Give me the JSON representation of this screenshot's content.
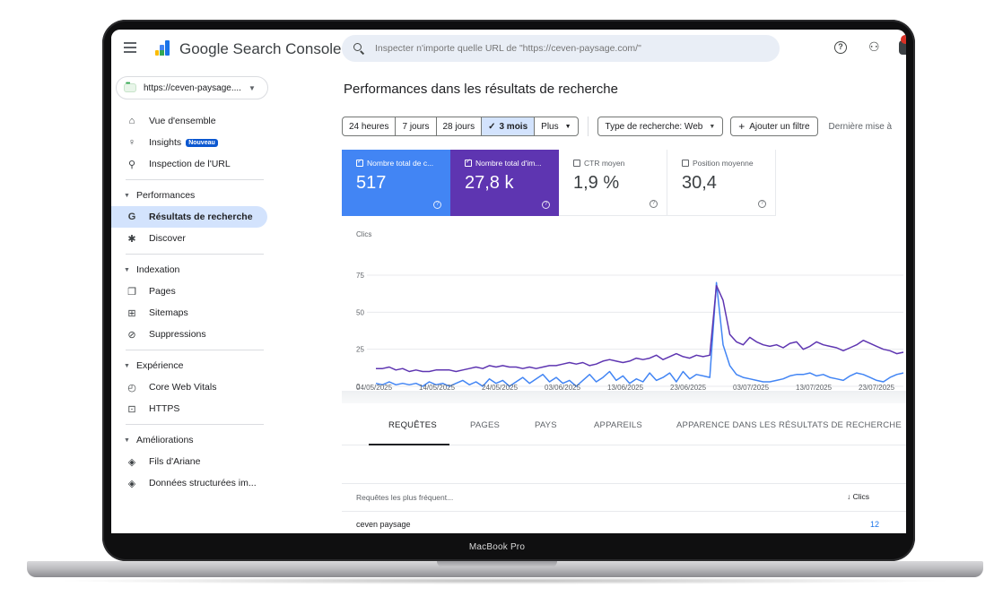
{
  "app": {
    "title": "Google Search Console",
    "search_placeholder": "Inspecter n'importe quelle URL de \"https://ceven-paysage.com/\"",
    "property": "https://ceven-paysage....",
    "device_label": "MacBook Pro"
  },
  "sidebar": {
    "top_items": [
      {
        "label": "Vue d'ensemble",
        "icon": "home-icon"
      },
      {
        "label": "Insights",
        "icon": "lightbulb-icon",
        "badge": "Nouveau"
      },
      {
        "label": "Inspection de l'URL",
        "icon": "search-icon"
      }
    ],
    "performance": {
      "header": "Performances",
      "items": [
        {
          "label": "Résultats de recherche",
          "icon": "google-g-icon"
        },
        {
          "label": "Discover",
          "icon": "asterisk-icon"
        }
      ]
    },
    "indexation": {
      "header": "Indexation",
      "items": [
        {
          "label": "Pages",
          "icon": "pages-icon"
        },
        {
          "label": "Sitemaps",
          "icon": "sitemap-icon"
        },
        {
          "label": "Suppressions",
          "icon": "visibility-off-icon"
        }
      ]
    },
    "experience": {
      "header": "Expérience",
      "items": [
        {
          "label": "Core Web Vitals",
          "icon": "speed-icon"
        },
        {
          "label": "HTTPS",
          "icon": "lock-icon"
        }
      ]
    },
    "ameliorations": {
      "header": "Améliorations",
      "items": [
        {
          "label": "Fils d'Ariane",
          "icon": "layers-icon"
        },
        {
          "label": "Données structurées im...",
          "icon": "layers-icon"
        }
      ]
    }
  },
  "main": {
    "page_title": "Performances dans les résultats de recherche",
    "date_ranges": [
      "24 heures",
      "7 jours",
      "28 jours",
      "3 mois",
      "Plus"
    ],
    "selected_range": "3 mois",
    "search_type": "Type de recherche: Web",
    "add_filter": "Ajouter un filtre",
    "last_update": "Dernière mise à"
  },
  "metrics": [
    {
      "label": "Nombre total de c...",
      "value": "517",
      "checked": true,
      "color": "#4285f4"
    },
    {
      "label": "Nombre total d'im...",
      "value": "27,8 k",
      "checked": true,
      "color": "#5e35b1"
    },
    {
      "label": "CTR moyen",
      "value": "1,9 %",
      "checked": false
    },
    {
      "label": "Position moyenne",
      "value": "30,4",
      "checked": false
    }
  ],
  "chart_data": {
    "type": "line",
    "ylabel": "Clics",
    "ylim": [
      0,
      75
    ],
    "yticks": [
      "0",
      "25",
      "50",
      "75"
    ],
    "xticks": [
      "04/05/2025",
      "14/05/2025",
      "24/05/2025",
      "03/06/2025",
      "13/06/2025",
      "23/06/2025",
      "03/07/2025",
      "13/07/2025",
      "23/07/2025"
    ],
    "grid": true,
    "series": [
      {
        "color": "#4285f4",
        "values": [
          2,
          1,
          3,
          1,
          2,
          1,
          2,
          0,
          3,
          1,
          2,
          0,
          2,
          4,
          1,
          3,
          0,
          5,
          2,
          4,
          0,
          3,
          6,
          2,
          5,
          8,
          3,
          6,
          2,
          4,
          0,
          4,
          8,
          3,
          6,
          10,
          4,
          7,
          2,
          5,
          3,
          9,
          4,
          6,
          9,
          3,
          10,
          5,
          8,
          7,
          6,
          70,
          28,
          14,
          8,
          6,
          5,
          4,
          3,
          3,
          4,
          5,
          7,
          8,
          8,
          9,
          7,
          8,
          6,
          5,
          4,
          7,
          9,
          8,
          6,
          4,
          3,
          6,
          8,
          9
        ]
      },
      {
        "color": "#5e35b1",
        "values": [
          12,
          12,
          13,
          11,
          12,
          10,
          11,
          10,
          10,
          11,
          11,
          11,
          10,
          11,
          12,
          13,
          12,
          14,
          13,
          14,
          13,
          13,
          12,
          13,
          12,
          13,
          14,
          14,
          15,
          16,
          15,
          16,
          14,
          15,
          17,
          18,
          17,
          16,
          17,
          19,
          18,
          19,
          21,
          18,
          20,
          22,
          20,
          19,
          21,
          20,
          21,
          68,
          58,
          35,
          30,
          28,
          33,
          30,
          28,
          27,
          28,
          26,
          29,
          30,
          25,
          27,
          30,
          28,
          27,
          26,
          24,
          26,
          28,
          31,
          29,
          27,
          25,
          24,
          22,
          23
        ]
      }
    ]
  },
  "tabs": [
    "REQUÊTES",
    "PAGES",
    "PAYS",
    "APPAREILS",
    "APPARENCE DANS LES RÉSULTATS DE RECHERCHE"
  ],
  "table": {
    "col_query": "Requêtes les plus fréquent...",
    "col_clicks": "Clics",
    "rows": [
      {
        "query": "ceven paysage",
        "clicks": "12"
      }
    ]
  }
}
